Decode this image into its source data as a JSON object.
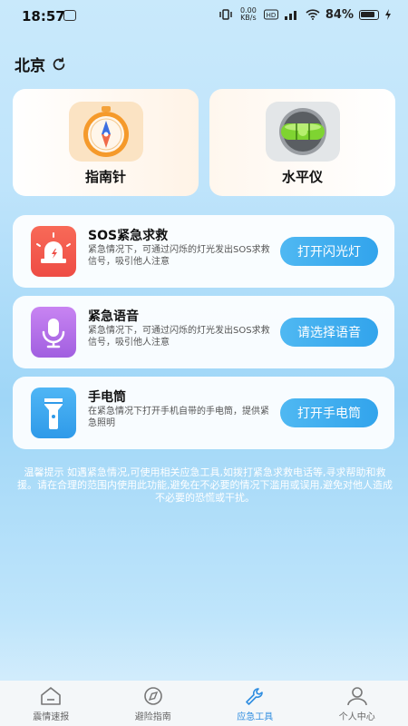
{
  "status_bar": {
    "time": "18:57",
    "network_speed": "0.00\nKB/s",
    "battery_pct": "84%"
  },
  "city": {
    "name": "北京",
    "icon": "refresh-icon"
  },
  "tools": [
    {
      "label": "指南针",
      "icon": "compass-icon"
    },
    {
      "label": "水平仪",
      "icon": "level-icon"
    }
  ],
  "features": [
    {
      "title": "SOS紧急求救",
      "desc": "紧急情况下，可通过闪烁的灯光发出SOS求救信号，吸引他人注意",
      "button": "打开闪光灯",
      "icon": "alarm-icon",
      "icon_color": "#f05a4c"
    },
    {
      "title": "紧急语音",
      "desc": "紧急情况下，可通过闪烁的灯光发出SOS求救信号，吸引他人注意",
      "button": "请选择语音",
      "icon": "microphone-icon",
      "icon_color": "#b56ee8"
    },
    {
      "title": "手电筒",
      "desc": "在紧急情况下打开手机自带的手电筒，提供紧急照明",
      "button": "打开手电筒",
      "icon": "flashlight-icon",
      "icon_color": "#3aa6f0"
    }
  ],
  "tip": "温馨提示 如遇紧急情况,可使用相关应急工具,如拨打紧急求救电话等,寻求帮助和救援。请在合理的范围内使用此功能,避免在不必要的情况下滥用或误用,避免对他人造成不必要的恐慌或干扰。",
  "tabs": [
    {
      "label": "震情速报",
      "icon": "home-icon"
    },
    {
      "label": "避险指南",
      "icon": "compass-icon"
    },
    {
      "label": "应急工具",
      "icon": "wrench-icon",
      "active": true
    },
    {
      "label": "个人中心",
      "icon": "user-icon"
    }
  ],
  "colors": {
    "accent": "#2f8de0",
    "button": "#3aa8ee"
  }
}
